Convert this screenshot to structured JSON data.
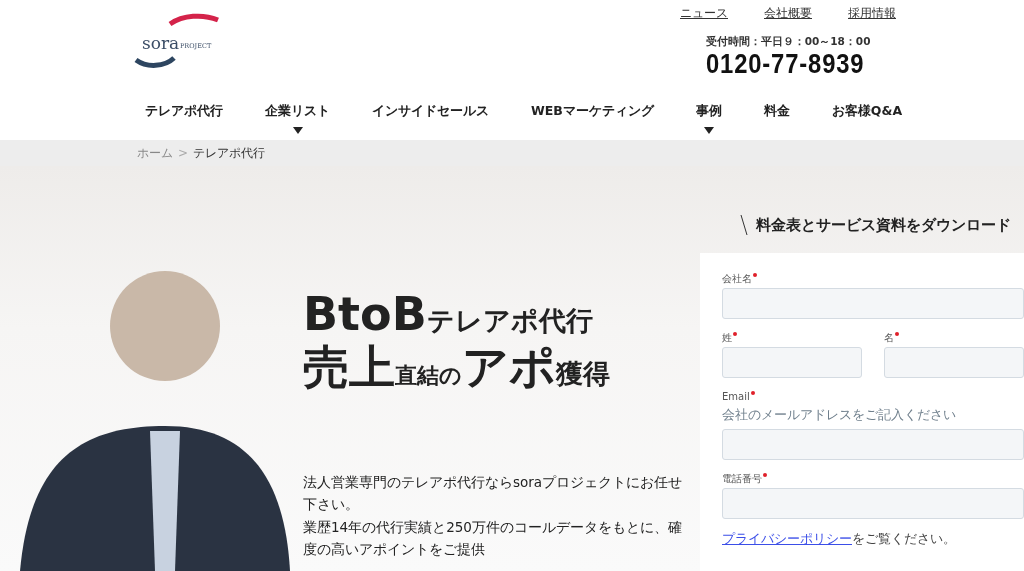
{
  "logo": {
    "text": "sora",
    "sub": "PROJECT"
  },
  "top_links": [
    "ニュース",
    "会社概要",
    "採用情報"
  ],
  "contact": {
    "hours": "受付時間：平日９：00～18：00",
    "phone": "0120-77-8939"
  },
  "nav": [
    {
      "label": "テレアポ代行",
      "dropdown": false
    },
    {
      "label": "企業リスト",
      "dropdown": true
    },
    {
      "label": "インサイドセールス",
      "dropdown": false
    },
    {
      "label": "WEBマーケティング",
      "dropdown": false
    },
    {
      "label": "事例",
      "dropdown": true
    },
    {
      "label": "料金",
      "dropdown": false
    },
    {
      "label": "お客様Q&A",
      "dropdown": false
    }
  ],
  "breadcrumb": [
    {
      "label": "ホーム",
      "kind": "link"
    },
    {
      "label": ">",
      "kind": "separator"
    },
    {
      "label": "テレアポ代行",
      "kind": "current"
    }
  ],
  "hero": {
    "headline_lines": [
      [
        {
          "text": "BtoB",
          "kind": "large"
        },
        {
          "text": "テレアポ代行",
          "kind": "medium"
        }
      ],
      [
        {
          "text": "売上",
          "kind": "large"
        },
        {
          "text": "直結の",
          "kind": "small"
        },
        {
          "text": "アポ",
          "kind": "large"
        },
        {
          "text": "獲得",
          "kind": "medium"
        }
      ]
    ],
    "paragraphs": [
      "法人営業専門のテレアポ代行ならsoraプロジェクトにお任せ下さい。",
      "業歴14年の代行実績と250万件のコールデータをもとに、確度の高いアポイントをご提供"
    ]
  },
  "form": {
    "title": "料金表とサービス資料をダウンロード",
    "fields": [
      [
        {
          "label": "会社名",
          "required": true
        }
      ],
      [
        {
          "label": "姓",
          "required": true
        },
        {
          "label": "名",
          "required": true
        }
      ],
      [
        {
          "label": "Email",
          "required": true,
          "hint": "会社のメールアドレスをご記入ください"
        }
      ],
      [
        {
          "label": "電話番号",
          "required": true
        }
      ]
    ],
    "privacy": {
      "link": "プライバシーポリシー",
      "text": "をご覧ください。"
    }
  }
}
